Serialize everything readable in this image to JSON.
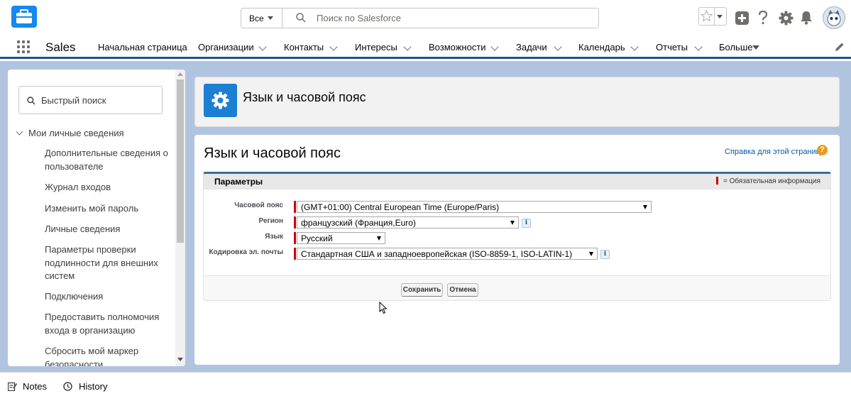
{
  "header": {
    "search_scope": "Все",
    "search_placeholder": "Поиск по Salesforce"
  },
  "nav": {
    "app_name": "Sales",
    "items": [
      {
        "label": "Начальная страница",
        "has_menu": false
      },
      {
        "label": "Организации",
        "has_menu": true
      },
      {
        "label": "Контакты",
        "has_menu": true
      },
      {
        "label": "Интересы",
        "has_menu": true
      },
      {
        "label": "Возможности",
        "has_menu": true
      },
      {
        "label": "Задачи",
        "has_menu": true
      },
      {
        "label": "Календарь",
        "has_menu": true
      },
      {
        "label": "Отчеты",
        "has_menu": true
      }
    ],
    "more_label": "Больше"
  },
  "sidebar": {
    "search_placeholder": "Быстрый поиск",
    "section_label": "Мои личные сведения",
    "items": [
      "Дополнительные сведения о пользователе",
      "Журнал входов",
      "Изменить мой пароль",
      "Личные сведения",
      "Параметры проверки подлинности для внешних систем",
      "Подключения",
      "Предоставить полномочия входа в организацию",
      "Сбросить мой маркер безопасности"
    ]
  },
  "page_header": {
    "title": "Язык и часовой пояс"
  },
  "main": {
    "title": "Язык и часовой пояс",
    "help_link": "Справка для этой страницы",
    "help_icon": "?",
    "section_title": "Параметры",
    "required_legend": "= Обязательная информация",
    "fields": [
      {
        "label": "Часовой пояс",
        "value": "(GMT+01:00) Central European Time (Europe/Paris)",
        "has_info": false
      },
      {
        "label": "Регион",
        "value": "французский (Франция,Euro)",
        "has_info": true
      },
      {
        "label": "Язык",
        "value": "Русский",
        "has_info": false
      },
      {
        "label": "Кодировка эл. почты",
        "value": "Стандартная США и западноевропейская (ISO-8859-1, ISO-LATIN-1)",
        "has_info": true
      }
    ],
    "info_glyph": "i",
    "save_label": "Сохранить",
    "cancel_label": "Отмена"
  },
  "footer": {
    "notes_label": "Notes",
    "history_label": "History"
  },
  "colors": {
    "brand_blue": "#1b5297",
    "gear_tile": "#1b7fd4",
    "required_red": "#cc0000",
    "page_background": "#b0c4df"
  }
}
